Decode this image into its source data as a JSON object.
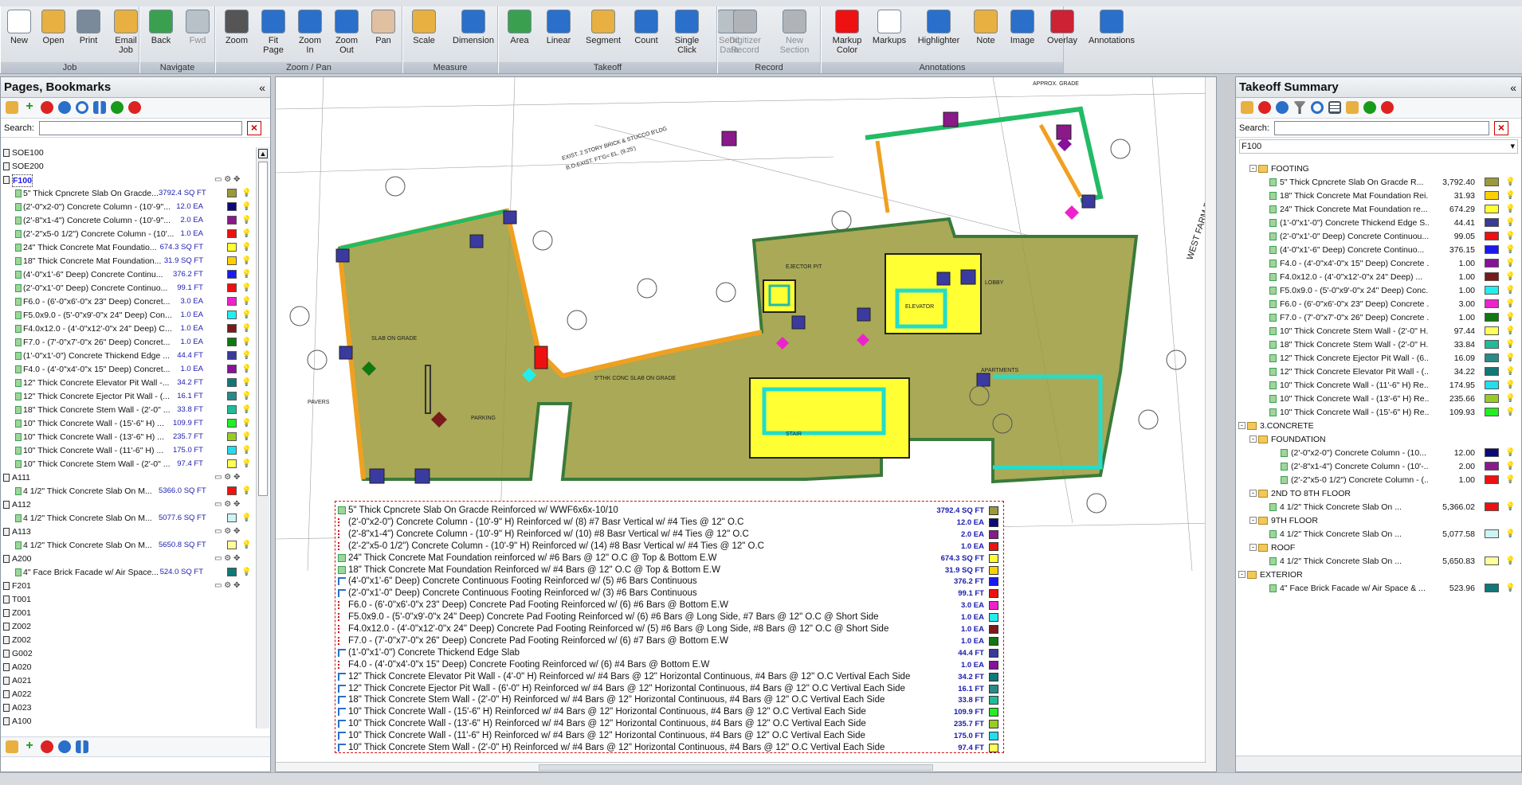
{
  "ribbon": {
    "groups": [
      {
        "label": "Job",
        "buttons": [
          "New",
          "Open",
          "Print",
          "Email\nJob"
        ]
      },
      {
        "label": "Navigate",
        "buttons": [
          "Back",
          "Fwd"
        ]
      },
      {
        "label": "Zoom / Pan",
        "buttons": [
          "Zoom",
          "Fit\nPage",
          "Zoom\nIn",
          "Zoom\nOut",
          "Pan"
        ]
      },
      {
        "label": "Measure",
        "buttons": [
          "Scale",
          "Dimension"
        ]
      },
      {
        "label": "Takeoff",
        "buttons": [
          "Area",
          "Linear",
          "Segment",
          "Count",
          "Single\nClick",
          "Send\nData"
        ]
      },
      {
        "label": "Record",
        "buttons": [
          "Digitizer\nRecord",
          "New\nSection"
        ]
      },
      {
        "label": "Annotations",
        "buttons": [
          "Markup\nColor",
          "Markups",
          "Highlighter",
          "Note",
          "Image",
          "Overlay",
          "Annotations"
        ]
      }
    ]
  },
  "left_panel": {
    "title": "Pages, Bookmarks",
    "search_label": "Search:",
    "items": [
      {
        "label": "SOE100",
        "indent": 0
      },
      {
        "label": "SOE200",
        "indent": 0
      },
      {
        "label": "F100",
        "indent": 0,
        "selected": true
      },
      {
        "label": "5\" Thick Cpncrete Slab On Gracde...",
        "qty": "3792.4",
        "unit": "SQ FT",
        "color": "#9a9a3a",
        "indent": 1
      },
      {
        "label": "(2'-0\"x2-0\") Concrete Column - (10'-9\"...",
        "qty": "12.0",
        "unit": "EA",
        "color": "#0a0a7a",
        "indent": 1
      },
      {
        "label": "(2'-8\"x1-4\") Concrete Column - (10'-9\"...",
        "qty": "2.0",
        "unit": "EA",
        "color": "#8a1a8a",
        "indent": 1
      },
      {
        "label": "(2'-2\"x5-0 1/2\") Concrete Column - (10'...",
        "qty": "1.0",
        "unit": "EA",
        "color": "#ee1111",
        "indent": 1
      },
      {
        "label": "24\" Thick Concrete Mat Foundatio...",
        "qty": "674.3",
        "unit": "SQ FT",
        "color": "#ffff33",
        "indent": 1
      },
      {
        "label": "18\" Thick Concrete Mat Foundation...",
        "qty": "31.9",
        "unit": "SQ FT",
        "color": "#ffd000",
        "indent": 1
      },
      {
        "label": "(4'-0\"x1'-6\" Deep) Concrete Continu...",
        "qty": "376.2",
        "unit": "FT",
        "color": "#1a1aee",
        "indent": 1
      },
      {
        "label": "(2'-0\"x1'-0\" Deep) Concrete Continuo...",
        "qty": "99.1",
        "unit": "FT",
        "color": "#ee1111",
        "indent": 1
      },
      {
        "label": "F6.0 - (6'-0\"x6'-0\"x 23\" Deep) Concret...",
        "qty": "3.0",
        "unit": "EA",
        "color": "#ee22cc",
        "indent": 1
      },
      {
        "label": "F5.0x9.0 - (5'-0\"x9'-0\"x 24\" Deep) Con...",
        "qty": "1.0",
        "unit": "EA",
        "color": "#22eeee",
        "indent": 1
      },
      {
        "label": "F4.0x12.0 - (4'-0\"x12'-0\"x 24\" Deep) C...",
        "qty": "1.0",
        "unit": "EA",
        "color": "#7a1a1a",
        "indent": 1
      },
      {
        "label": "F7.0 - (7'-0\"x7'-0\"x 26\" Deep) Concret...",
        "qty": "1.0",
        "unit": "EA",
        "color": "#117711",
        "indent": 1
      },
      {
        "label": "(1'-0\"x1'-0\") Concrete Thickend Edge ...",
        "qty": "44.4",
        "unit": "FT",
        "color": "#3a3a99",
        "indent": 1
      },
      {
        "label": "F4.0 - (4'-0\"x4'-0\"x 15\" Deep) Concret...",
        "qty": "1.0",
        "unit": "EA",
        "color": "#881199",
        "indent": 1
      },
      {
        "label": "12\" Thick Concrete Elevator Pit Wall -...",
        "qty": "34.2",
        "unit": "FT",
        "color": "#117777",
        "indent": 1
      },
      {
        "label": "12\" Thick Concrete Ejector Pit Wall - (...",
        "qty": "16.1",
        "unit": "FT",
        "color": "#2a8a8a",
        "indent": 1
      },
      {
        "label": "18\" Thick Concrete Stem Wall - (2'-0\" ...",
        "qty": "33.8",
        "unit": "FT",
        "color": "#22bb99",
        "indent": 1
      },
      {
        "label": "10\" Thick Concrete Wall - (15'-6\" H) ...",
        "qty": "109.9",
        "unit": "FT",
        "color": "#22ee22",
        "indent": 1
      },
      {
        "label": "10\" Thick Concrete Wall - (13'-6\" H) ...",
        "qty": "235.7",
        "unit": "FT",
        "color": "#99cc22",
        "indent": 1
      },
      {
        "label": "10\" Thick Concrete Wall - (11'-6\" H) ...",
        "qty": "175.0",
        "unit": "FT",
        "color": "#22ddee",
        "indent": 1
      },
      {
        "label": "10\" Thick Concrete Stem Wall - (2'-0\" ...",
        "qty": "97.4",
        "unit": "FT",
        "color": "#ffff55",
        "indent": 1
      },
      {
        "label": "A111",
        "indent": 0
      },
      {
        "label": "4 1/2\" Thick Concrete Slab On M...",
        "qty": "5366.0",
        "unit": "SQ FT",
        "color": "#ee1111",
        "indent": 1
      },
      {
        "label": "A112",
        "indent": 0
      },
      {
        "label": "4 1/2\" Thick Concrete Slab On M...",
        "qty": "5077.6",
        "unit": "SQ FT",
        "color": "#ccf4f4",
        "indent": 1
      },
      {
        "label": "A113",
        "indent": 0
      },
      {
        "label": "4 1/2\" Thick Concrete Slab On M...",
        "qty": "5650.8",
        "unit": "SQ FT",
        "color": "#ffff99",
        "indent": 1
      },
      {
        "label": "A200",
        "indent": 0
      },
      {
        "label": "4\" Face Brick Facade w/ Air Space...",
        "qty": "524.0",
        "unit": "SQ FT",
        "color": "#117777",
        "indent": 1
      },
      {
        "label": "F201",
        "indent": 0
      },
      {
        "label": "T001",
        "indent": 0
      },
      {
        "label": "Z001",
        "indent": 0
      },
      {
        "label": "Z002",
        "indent": 0
      },
      {
        "label": "Z002",
        "indent": 0
      },
      {
        "label": "G002",
        "indent": 0
      },
      {
        "label": "A020",
        "indent": 0
      },
      {
        "label": "A021",
        "indent": 0
      },
      {
        "label": "A022",
        "indent": 0
      },
      {
        "label": "A023",
        "indent": 0
      },
      {
        "label": "A100",
        "indent": 0
      }
    ]
  },
  "right_panel": {
    "title": "Takeoff Summary",
    "search_label": "Search:",
    "page_select": "F100",
    "items": [
      {
        "label": "FOOTING",
        "indent": 1,
        "folder": true
      },
      {
        "label": "5\" Thick Cpncrete Slab On Gracde R...",
        "qty": "3,792.40",
        "color": "#9a9a3a",
        "indent": 2
      },
      {
        "label": "18\" Thick Concrete Mat Foundation Rei...",
        "qty": "31.93",
        "color": "#ffd000",
        "indent": 2
      },
      {
        "label": "24\" Thick Concrete Mat Foundation re...",
        "qty": "674.29",
        "color": "#ffff33",
        "indent": 2
      },
      {
        "label": "(1'-0\"x1'-0\") Concrete Thickend Edge S...",
        "qty": "44.41",
        "color": "#3a3a99",
        "indent": 2
      },
      {
        "label": "(2'-0\"x1'-0\" Deep) Concrete Continuou...",
        "qty": "99.05",
        "color": "#ee1111",
        "indent": 2
      },
      {
        "label": "(4'-0\"x1'-6\" Deep) Concrete Continuo...",
        "qty": "376.15",
        "color": "#1a1aee",
        "indent": 2
      },
      {
        "label": "F4.0 - (4'-0\"x4'-0\"x 15\" Deep) Concrete ...",
        "qty": "1.00",
        "color": "#881199",
        "indent": 2
      },
      {
        "label": "F4.0x12.0 - (4'-0\"x12'-0\"x 24\" Deep) ...",
        "qty": "1.00",
        "color": "#7a1a1a",
        "indent": 2
      },
      {
        "label": "F5.0x9.0 - (5'-0\"x9'-0\"x 24\" Deep) Conc...",
        "qty": "1.00",
        "color": "#22eeee",
        "indent": 2
      },
      {
        "label": "F6.0 - (6'-0\"x6'-0\"x 23\" Deep) Concrete ...",
        "qty": "3.00",
        "color": "#ee22cc",
        "indent": 2
      },
      {
        "label": "F7.0 - (7'-0\"x7'-0\"x 26\" Deep) Concrete ...",
        "qty": "1.00",
        "color": "#117711",
        "indent": 2
      },
      {
        "label": "10\" Thick Concrete Stem Wall - (2'-0\" H...",
        "qty": "97.44",
        "color": "#ffff55",
        "indent": 2
      },
      {
        "label": "18\" Thick Concrete Stem Wall - (2'-0\" H...",
        "qty": "33.84",
        "color": "#22bb99",
        "indent": 2
      },
      {
        "label": "12\" Thick Concrete Ejector Pit Wall - (6...",
        "qty": "16.09",
        "color": "#2a8a8a",
        "indent": 2
      },
      {
        "label": "12\" Thick Concrete Elevator Pit Wall - (...",
        "qty": "34.22",
        "color": "#117777",
        "indent": 2
      },
      {
        "label": "10\" Thick Concrete Wall - (11'-6\" H) Re...",
        "qty": "174.95",
        "color": "#22ddee",
        "indent": 2
      },
      {
        "label": "10\" Thick Concrete Wall - (13'-6\" H) Re...",
        "qty": "235.66",
        "color": "#99cc22",
        "indent": 2
      },
      {
        "label": "10\" Thick Concrete Wall - (15'-6\" H) Re...",
        "qty": "109.93",
        "color": "#22ee22",
        "indent": 2
      },
      {
        "label": "3.CONCRETE",
        "indent": 0,
        "folder": true
      },
      {
        "label": "FOUNDATION",
        "indent": 1,
        "folder": true
      },
      {
        "label": "(2'-0\"x2-0\") Concrete Column - (10...",
        "qty": "12.00",
        "color": "#0a0a7a",
        "indent": 3
      },
      {
        "label": "(2'-8\"x1-4\") Concrete Column - (10'-...",
        "qty": "2.00",
        "color": "#8a1a8a",
        "indent": 3
      },
      {
        "label": "(2'-2\"x5-0 1/2\") Concrete Column - (...",
        "qty": "1.00",
        "color": "#ee1111",
        "indent": 3
      },
      {
        "label": "2ND TO 8TH FLOOR",
        "indent": 1,
        "folder": true
      },
      {
        "label": "4 1/2\" Thick Concrete Slab On ...",
        "qty": "5,366.02",
        "color": "#ee1111",
        "indent": 2
      },
      {
        "label": "9TH FLOOR",
        "indent": 1,
        "folder": true
      },
      {
        "label": "4 1/2\" Thick Concrete Slab On ...",
        "qty": "5,077.58",
        "color": "#ccf4f4",
        "indent": 2
      },
      {
        "label": "ROOF",
        "indent": 1,
        "folder": true
      },
      {
        "label": "4 1/2\" Thick Concrete Slab On ...",
        "qty": "5,650.83",
        "color": "#ffff99",
        "indent": 2
      },
      {
        "label": "EXTERIOR",
        "indent": 0,
        "folder": true
      },
      {
        "label": "4\" Face Brick Facade w/ Air Space & ...",
        "qty": "523.96",
        "color": "#117777",
        "indent": 2
      }
    ]
  },
  "legend": [
    {
      "text": "5\" Thick Cpncrete Slab On Gracde Reinforced w/ WWF6x6x-10/10",
      "qty": "3792.4 SQ FT",
      "color": "#9a9a3a",
      "kind": "area"
    },
    {
      "text": "(2'-0\"x2-0\") Concrete Column - (10'-9\" H) Reinforced w/ (8) #7 Basr Vertical w/ #4 Ties @ 12\" O.C",
      "qty": "12.0 EA",
      "color": "#0a0a7a",
      "kind": "count"
    },
    {
      "text": "(2'-8\"x1-4\") Concrete Column - (10'-9\" H) Reinforced w/ (10) #8 Basr Vertical w/ #4 Ties @ 12\" O.C",
      "qty": "2.0 EA",
      "color": "#8a1a8a",
      "kind": "count"
    },
    {
      "text": "(2'-2\"x5-0 1/2\") Concrete Column - (10'-9\" H) Reinforced w/ (14) #8 Basr Vertical w/ #4 Ties @ 12\" O.C",
      "qty": "1.0 EA",
      "color": "#ee1111",
      "kind": "count"
    },
    {
      "text": "24\" Thick Concrete Mat Foundation reinforced w/ #6 Bars @ 12\" O.C @ Top & Bottom E.W",
      "qty": "674.3 SQ FT",
      "color": "#ffff33",
      "kind": "area"
    },
    {
      "text": "18\" Thick Concrete Mat Foundation Reinforced w/ #4 Bars @ 12\" O.C @ Top & Bottom E.W",
      "qty": "31.9 SQ FT",
      "color": "#ffd000",
      "kind": "area"
    },
    {
      "text": "(4'-0\"x1'-6\" Deep) Concrete Continuous Footing Reinforced w/ (5) #6 Bars Continuous",
      "qty": "376.2 FT",
      "color": "#1a1aee",
      "kind": "linear"
    },
    {
      "text": "(2'-0\"x1'-0\" Deep) Concrete Continuous Footing Reinforced w/ (3) #6 Bars Continuous",
      "qty": "99.1 FT",
      "color": "#ee1111",
      "kind": "linear"
    },
    {
      "text": "F6.0 - (6'-0\"x6'-0\"x 23\" Deep) Concrete Pad Footing Reinforced w/ (6) #6 Bars @ Bottom E.W",
      "qty": "3.0 EA",
      "color": "#ee22cc",
      "kind": "count"
    },
    {
      "text": "F5.0x9.0 - (5'-0\"x9'-0\"x 24\" Deep) Concrete Pad Footing Reinforced w/ (6) #6 Bars @ Long Side, #7 Bars @ 12\" O.C @ Short Side",
      "qty": "1.0 EA",
      "color": "#22eeee",
      "kind": "count"
    },
    {
      "text": "F4.0x12.0 - (4'-0\"x12'-0\"x 24\" Deep) Concrete Pad Footing Reinforced w/ (5) #6 Bars @ Long Side, #8 Bars @ 12\" O.C @ Short Side",
      "qty": "1.0 EA",
      "color": "#7a1a1a",
      "kind": "count"
    },
    {
      "text": "F7.0 - (7'-0\"x7'-0\"x 26\" Deep) Concrete Pad Footing Reinforced w/ (6) #7 Bars @ Bottom E.W",
      "qty": "1.0 EA",
      "color": "#117711",
      "kind": "count"
    },
    {
      "text": "(1'-0\"x1'-0\") Concrete Thickend Edge Slab",
      "qty": "44.4 FT",
      "color": "#3a3a99",
      "kind": "linear"
    },
    {
      "text": "F4.0 - (4'-0\"x4'-0\"x 15\" Deep) Concrete Footing Reinforced w/ (6) #4 Bars @ Bottom E.W",
      "qty": "1.0 EA",
      "color": "#881199",
      "kind": "count"
    },
    {
      "text": "12\" Thick Concrete Elevator Pit Wall - (4'-0\" H) Reinforced w/ #4 Bars @ 12\" Horizontal Continuous, #4 Bars @ 12\" O.C Vertival Each Side",
      "qty": "34.2 FT",
      "color": "#117777",
      "kind": "linear"
    },
    {
      "text": "12\" Thick Concrete Ejector Pit Wall - (6'-0\" H) Reinforced w/ #4 Bars @ 12\" Horizontal Continuous, #4 Bars @ 12\" O.C Vertival Each Side",
      "qty": "16.1 FT",
      "color": "#2a8a8a",
      "kind": "linear"
    },
    {
      "text": "18\" Thick Concrete Stem Wall - (2'-0\" H) Reinforced w/ #4 Bars @ 12\" Horizontal Continuous, #4 Bars @ 12\" O.C Vertival Each Side",
      "qty": "33.8 FT",
      "color": "#22bb99",
      "kind": "linear"
    },
    {
      "text": "10\" Thick Concrete Wall - (15'-6\" H) Reinforced w/ #4 Bars @ 12\" Horizontal Continuous, #4 Bars @ 12\" O.C Vertival Each Side",
      "qty": "109.9 FT",
      "color": "#22ee22",
      "kind": "linear"
    },
    {
      "text": "10\" Thick Concrete Wall - (13'-6\" H) Reinforced w/ #4 Bars @ 12\" Horizontal Continuous, #4 Bars @ 12\" O.C Vertival Each Side",
      "qty": "235.7 FT",
      "color": "#99cc22",
      "kind": "linear"
    },
    {
      "text": "10\" Thick Concrete Wall - (11'-6\" H) Reinforced w/ #4 Bars @ 12\" Horizontal Continuous, #4 Bars @ 12\" O.C Vertival Each Side",
      "qty": "175.0 FT",
      "color": "#22ddee",
      "kind": "linear"
    },
    {
      "text": "10\" Thick Concrete Stem Wall - (2'-0\" H) Reinforced w/ #4 Bars @ 12\" Horizontal Continuous, #4 Bars @ 12\" O.C Vertival Each Side",
      "qty": "97.4 FT",
      "color": "#ffff55",
      "kind": "linear"
    }
  ],
  "drawing": {
    "road_label": "WEST FARM ROAD",
    "bldg_label1": "EXIST. 2 STORY BRICK & STUCCO B'LDG",
    "bldg_label2": "B.O.EXIST. FT'G= EL. (9.25')",
    "room_labels": [
      "LOBBY",
      "ELEVATOR",
      "STAIR",
      "APARTMENTS",
      "PARKING",
      "EJECTOR PIT",
      "PAVERS",
      "APPROX. GRADE"
    ]
  }
}
